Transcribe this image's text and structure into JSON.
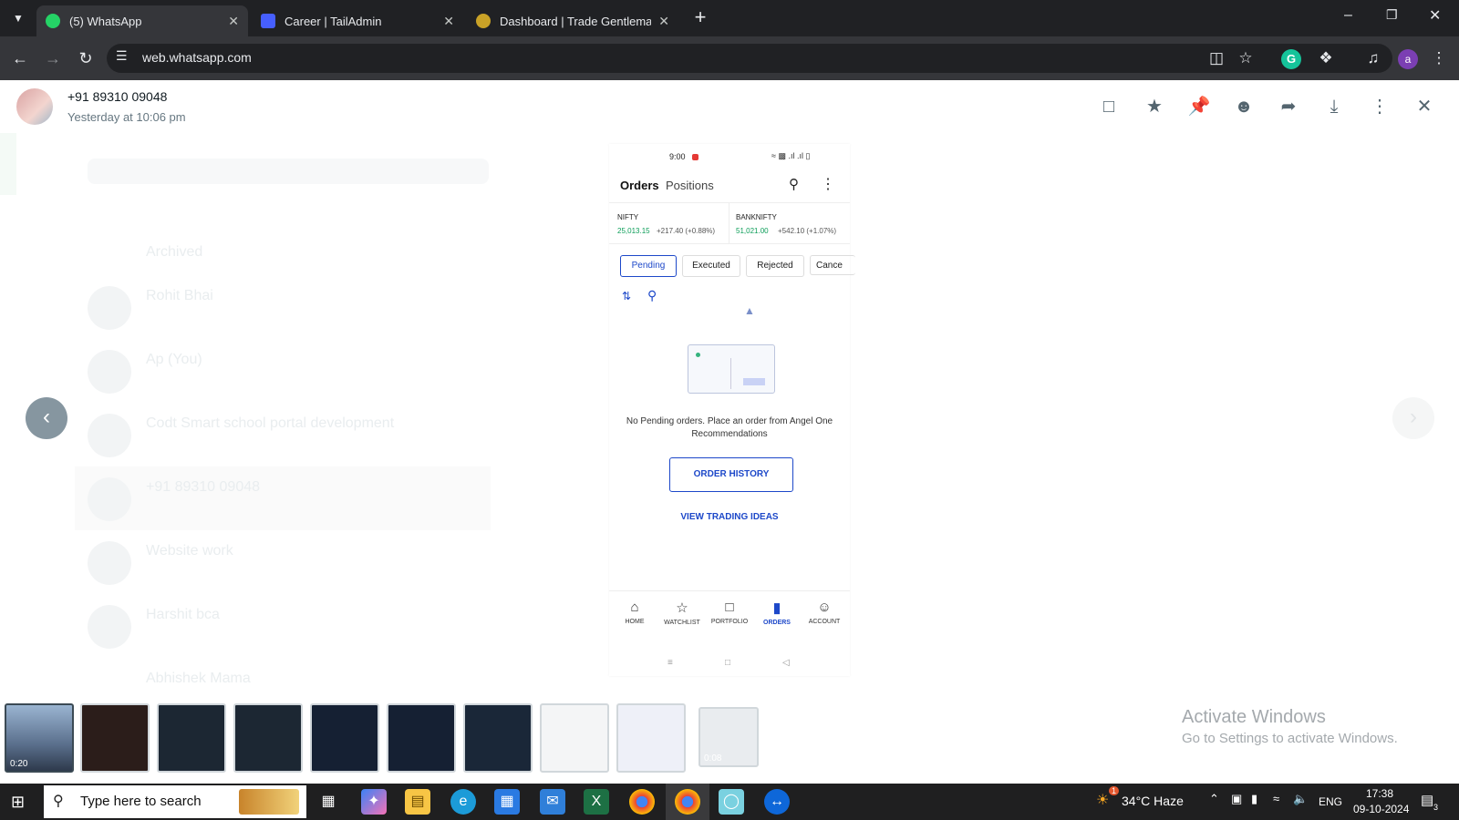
{
  "browser": {
    "tabs": [
      {
        "label": "(5) WhatsApp",
        "active": true,
        "favicon_color": "#25d366"
      },
      {
        "label": "Career | TailAdmin",
        "active": false,
        "favicon_color": "#465fff"
      },
      {
        "label": "Dashboard | Trade Gentleman A",
        "active": false,
        "favicon_color": "#c9a227"
      }
    ],
    "new_tab_label": "+",
    "url": "web.whatsapp.com",
    "profile_initial": "a"
  },
  "viewer": {
    "sender": "+91 89310 09048",
    "timestamp": "Yesterday at 10:06 pm",
    "action_icons": [
      "message-icon",
      "star-icon",
      "pin-icon",
      "emoji-icon",
      "forward-icon",
      "download-icon",
      "more-icon",
      "close-icon"
    ]
  },
  "phone": {
    "status_time": "9:00",
    "tabs": {
      "orders": "Orders",
      "positions": "Positions"
    },
    "indices": [
      {
        "name": "NIFTY",
        "value": "25,013.15",
        "change": "+217.40 (+0.88%)"
      },
      {
        "name": "BANKNIFTY",
        "value": "51,021.00",
        "change": "+542.10 (+1.07%)"
      }
    ],
    "filters": [
      "Pending",
      "Executed",
      "Rejected",
      "Cance"
    ],
    "empty_message": "No Pending orders. Place an order from Angel One Recommendations",
    "order_history": "ORDER HISTORY",
    "view_ideas": "VIEW TRADING IDEAS",
    "bottom_nav": [
      "HOME",
      "WATCHLIST",
      "PORTFOLIO",
      "ORDERS",
      "ACCOUNT"
    ],
    "accent": "#1d48c9",
    "green": "#0b9d58"
  },
  "thumbnails": [
    {
      "badge": "0:20"
    },
    {
      "badge": ""
    },
    {
      "badge": ""
    },
    {
      "badge": ""
    },
    {
      "badge": ""
    },
    {
      "badge": ""
    },
    {
      "badge": ""
    },
    {
      "badge": ""
    },
    {
      "badge": ""
    },
    {
      "badge": "0:08"
    }
  ],
  "windows_notice": {
    "title": "Activate Windows",
    "subtitle": "Go to Settings to activate Windows."
  },
  "taskbar": {
    "search_placeholder": "Type here to search",
    "weather": "34°C  Haze",
    "language": "ENG",
    "time": "17:38",
    "date": "09-10-2024",
    "notification_count": "3",
    "weather_badge": "1"
  },
  "background_chats": [
    {
      "name": "Archived"
    },
    {
      "name": "Rohit Bhai"
    },
    {
      "name": "Ap (You)"
    },
    {
      "name": "Codt Smart school portal development"
    },
    {
      "name": "+91 89310 09048"
    },
    {
      "name": "Website work"
    },
    {
      "name": "Harshit bca"
    },
    {
      "name": "Abhishek Mama"
    }
  ]
}
